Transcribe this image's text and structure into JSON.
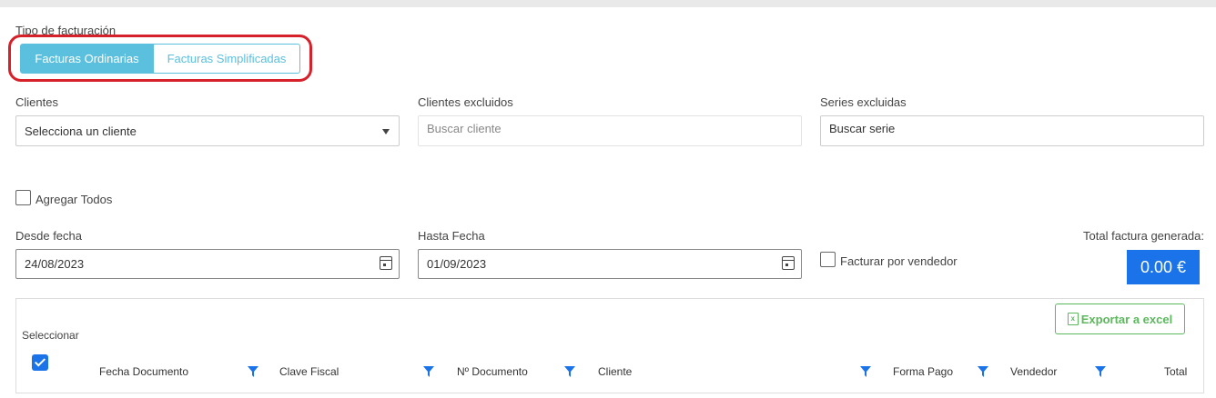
{
  "billing_type": {
    "label": "Tipo de facturación",
    "options": [
      "Facturas Ordinarias",
      "Facturas Simplificadas"
    ],
    "selected": "Facturas Ordinarias"
  },
  "clients": {
    "label": "Clientes",
    "value": "Selecciona un cliente"
  },
  "excluded_clients": {
    "label": "Clientes excluidos",
    "placeholder": "Buscar cliente"
  },
  "excluded_series": {
    "label": "Series excluidas",
    "placeholder": "Buscar serie"
  },
  "add_all": {
    "label": "Agregar Todos",
    "checked": false
  },
  "from_date": {
    "label": "Desde fecha",
    "value": "24/08/2023"
  },
  "to_date": {
    "label": "Hasta Fecha",
    "value": "01/09/2023"
  },
  "by_seller": {
    "label": "Facturar por vendedor",
    "checked": false
  },
  "total": {
    "label": "Total factura generada:",
    "value": "0.00 €"
  },
  "table": {
    "export_label": "Exportar a excel",
    "select_label": "Seleccionar",
    "select_all_checked": true,
    "columns": [
      "Fecha Documento",
      "Clave Fiscal",
      "Nº Documento",
      "Cliente",
      "Forma Pago",
      "Vendedor",
      "Total"
    ]
  },
  "colors": {
    "accent": "#5bc0de",
    "primary": "#1a73e8",
    "success": "#5cb85c",
    "highlight": "#d6202a"
  },
  "icons": [
    "dropdown-caret-icon",
    "calendar-icon",
    "excel-icon",
    "filter-icon",
    "check-icon"
  ]
}
